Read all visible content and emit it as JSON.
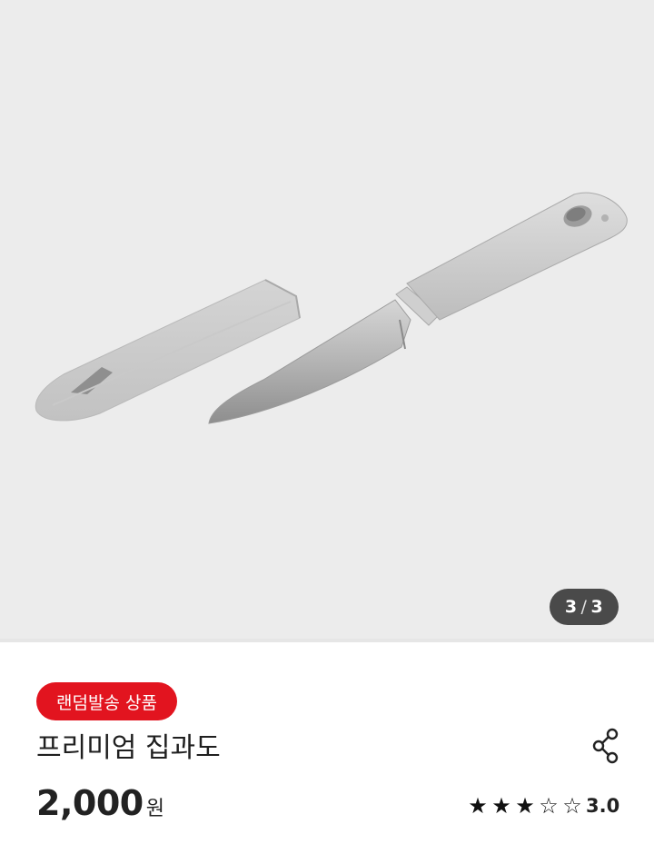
{
  "gallery": {
    "image_icon": "paring-knife-with-sheath",
    "current_index": "3",
    "separator": "/",
    "total": "3",
    "background_color": "#ececec"
  },
  "product": {
    "badge": "랜덤발송 상품",
    "badge_color": "#e2141f",
    "title": "프리미엄 집과도",
    "price_amount": "2,000",
    "price_unit": "원",
    "share_icon": "share-icon"
  },
  "rating": {
    "value": 3,
    "max": 5,
    "score_text": "3.0",
    "filled_star": "★",
    "empty_star": "☆"
  }
}
